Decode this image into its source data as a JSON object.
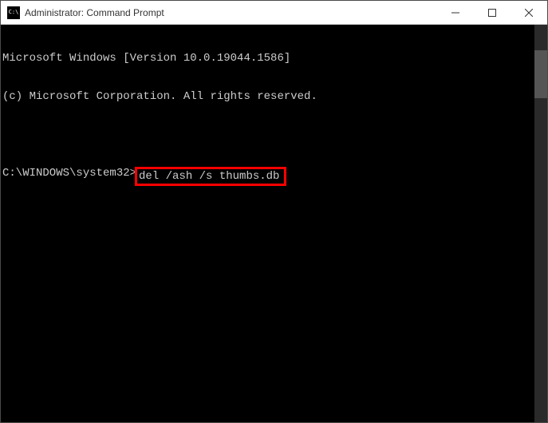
{
  "window": {
    "title": "Administrator: Command Prompt"
  },
  "terminal": {
    "line1": "Microsoft Windows [Version 10.0.19044.1586]",
    "line2": "(c) Microsoft Corporation. All rights reserved.",
    "prompt": "C:\\WINDOWS\\system32>",
    "command": "del /ash /s thumbs.db"
  }
}
